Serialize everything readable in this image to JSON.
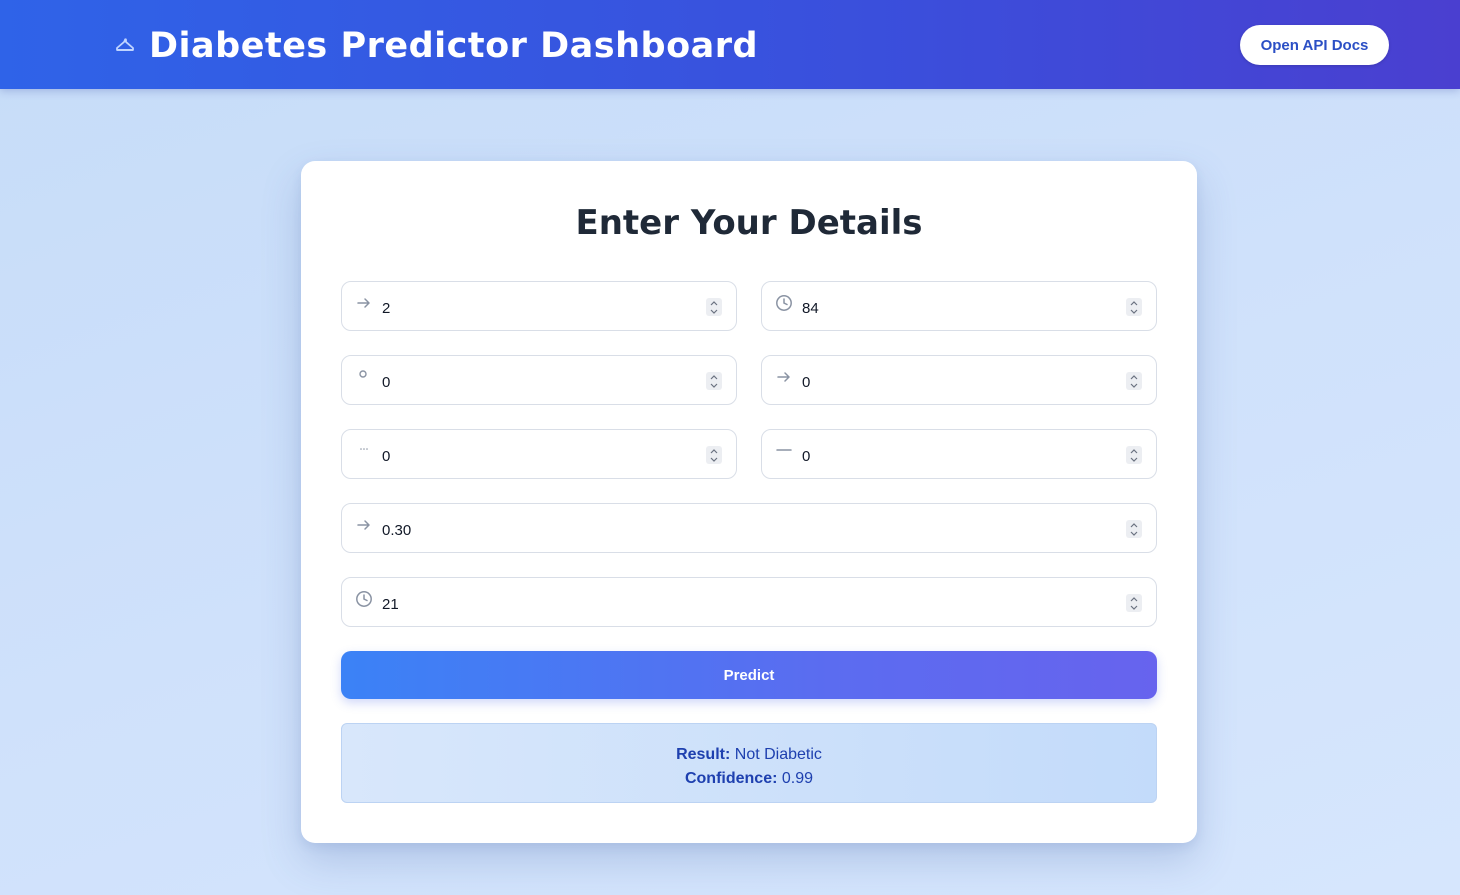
{
  "header": {
    "title": "Diabetes Predictor Dashboard",
    "logo_icon": "syringe-icon",
    "api_docs_label": "Open API Docs"
  },
  "form": {
    "heading": "Enter Your Details",
    "fields": [
      {
        "icon": "arrow-right-icon",
        "value": "2"
      },
      {
        "icon": "clock-icon",
        "value": "84"
      },
      {
        "icon": "circle-icon",
        "value": "0"
      },
      {
        "icon": "arrow-right-icon",
        "value": "0"
      },
      {
        "icon": "ellipsis-icon",
        "value": "0"
      },
      {
        "icon": "minus-icon",
        "value": "0"
      },
      {
        "icon": "arrow-right-icon",
        "value": "0.30"
      },
      {
        "icon": "clock-icon",
        "value": "21"
      }
    ],
    "predict_label": "Predict"
  },
  "result": {
    "result_label": "Result:",
    "result_value": "Not Diabetic",
    "confidence_label": "Confidence:",
    "confidence_value": "0.99"
  },
  "colors": {
    "header_start": "#2f63e8",
    "header_end": "#4a3fd0",
    "accent": "#2b4fc5",
    "result_text": "#1e40af"
  }
}
